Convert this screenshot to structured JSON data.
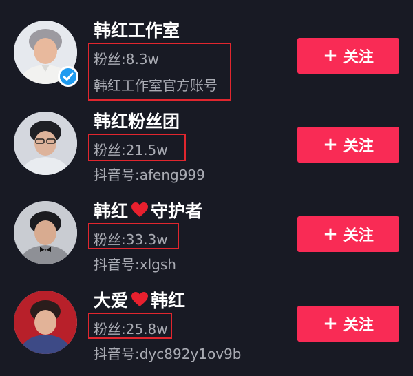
{
  "accounts": [
    {
      "name": "韩红工作室",
      "fans": "粉丝:8.3w",
      "sub": "韩红工作室官方账号",
      "verified": true,
      "follow_label": "关注"
    },
    {
      "name": "韩红粉丝团",
      "fans": "粉丝:21.5w",
      "sub": "抖音号:afeng999",
      "follow_label": "关注"
    },
    {
      "name_before": "韩红",
      "name_after": "守护者",
      "fans": "粉丝:33.3w",
      "sub": "抖音号:xlgsh",
      "follow_label": "关注"
    },
    {
      "name_before": "大爱",
      "name_after": "韩红",
      "fans": "粉丝:25.8w",
      "sub": "抖音号:dyc892y1ov9b",
      "follow_label": "关注"
    }
  ],
  "icons": {
    "plus": "+",
    "heart": "heart-icon",
    "verified": "checkmark-icon"
  },
  "colors": {
    "background": "#181a24",
    "follow_button": "#f92b55",
    "highlight_box": "#e0262e",
    "verified_badge": "#1f9bf0",
    "heart": "#e8202e"
  }
}
